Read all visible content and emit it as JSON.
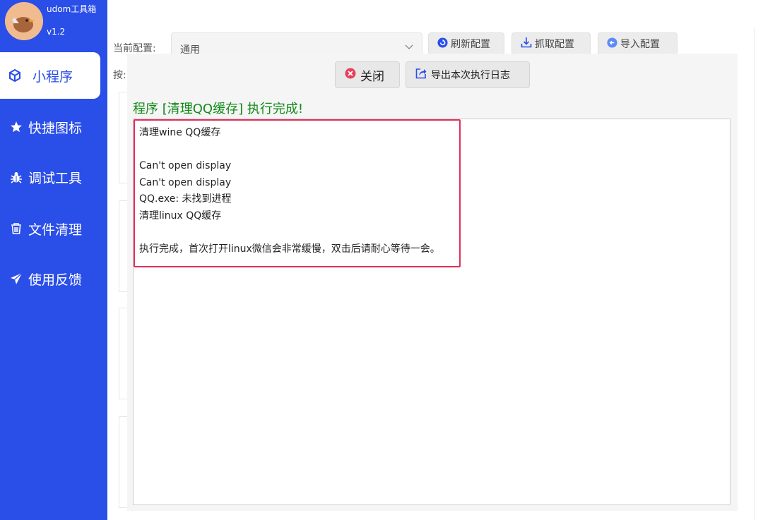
{
  "app": {
    "name": "udom工具箱",
    "version": "v1.2"
  },
  "sidebar": {
    "items": [
      {
        "label": "小程序",
        "icon": "cube-icon",
        "active": true
      },
      {
        "label": "快捷图标",
        "icon": "star-icon",
        "active": false
      },
      {
        "label": "调试工具",
        "icon": "bug-icon",
        "active": false
      },
      {
        "label": "文件清理",
        "icon": "trash-icon",
        "active": false
      },
      {
        "label": "使用反馈",
        "icon": "paper-plane-icon",
        "active": false
      }
    ]
  },
  "config": {
    "label": "当前配置:",
    "selected": "通用",
    "refresh_label": "刷新配置",
    "fetch_label": "抓取配置",
    "import_label": "导入配置",
    "hint_label": "按:"
  },
  "dialog": {
    "close_label": "关闭",
    "export_label": "导出本次执行日志",
    "status_title": "程序 [清理QQ缓存] 执行完成!",
    "log_lines": [
      "清理wine QQ缓存",
      "",
      "Can't open display",
      "Can't open display",
      "QQ.exe: 未找到进程",
      "清理linux QQ缓存",
      "",
      "执行完成，首次打开linux微信会非常缓慢，双击后请耐心等待一会。"
    ]
  },
  "colors": {
    "sidebar_bg": "#2a4ee8",
    "status_green": "#118a18",
    "highlight_border": "#e0305a",
    "close_icon_red": "#e8405a",
    "refresh_icon_blue": "#2a4ee8"
  }
}
